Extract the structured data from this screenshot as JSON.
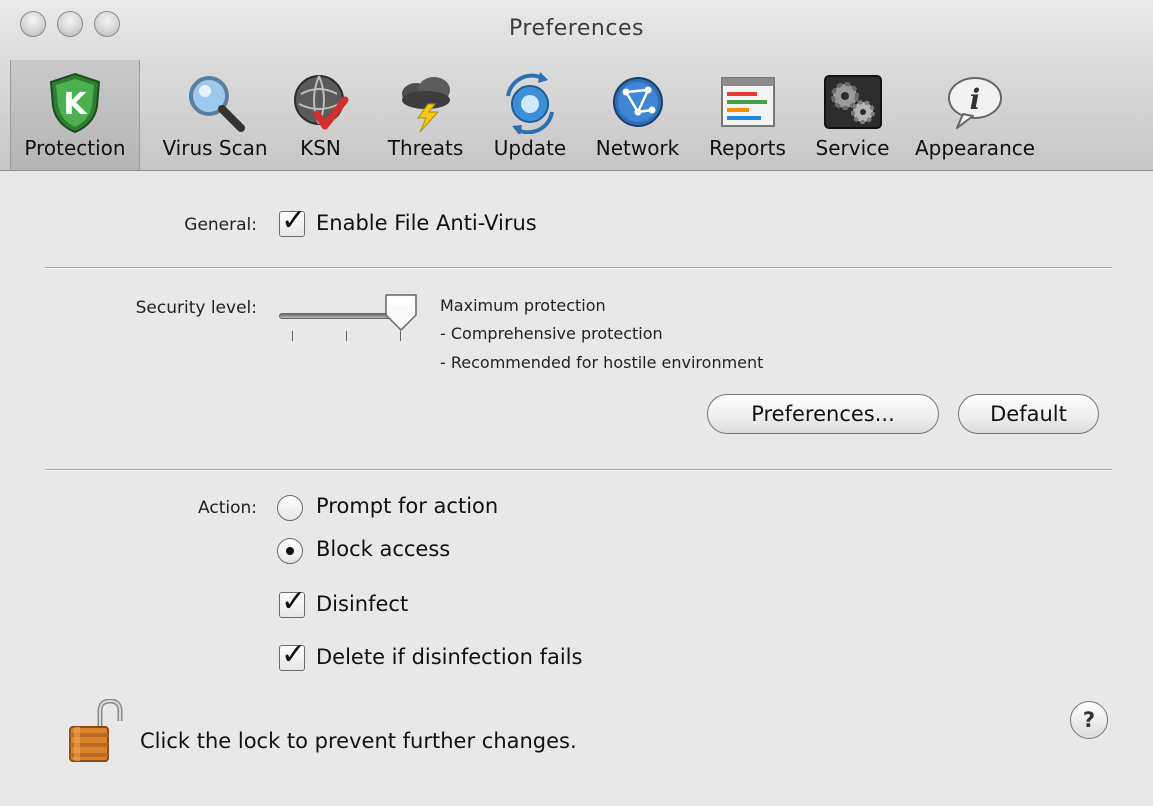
{
  "window": {
    "title": "Preferences"
  },
  "toolbar": {
    "items": [
      {
        "label": "Protection",
        "icon": "shield-k-icon",
        "selected": true
      },
      {
        "label": "Virus Scan",
        "icon": "magnifier-icon"
      },
      {
        "label": "KSN",
        "icon": "ksn-globe-icon"
      },
      {
        "label": "Threats",
        "icon": "storm-cloud-icon"
      },
      {
        "label": "Update",
        "icon": "update-orbit-icon"
      },
      {
        "label": "Network",
        "icon": "network-globe-icon"
      },
      {
        "label": "Reports",
        "icon": "report-sheet-icon"
      },
      {
        "label": "Service",
        "icon": "gears-icon"
      },
      {
        "label": "Appearance",
        "icon": "info-bubble-icon"
      }
    ]
  },
  "general": {
    "label": "General:",
    "enable_label": "Enable File Anti-Virus",
    "enabled": true
  },
  "security": {
    "label": "Security level:",
    "level_index": 2,
    "levels": 3,
    "description": [
      "Maximum protection",
      "- Comprehensive protection",
      "- Recommended for hostile environment"
    ],
    "preferences_button": "Preferences...",
    "default_button": "Default"
  },
  "action": {
    "label": "Action:",
    "options": [
      {
        "label": "Prompt for action",
        "selected": false
      },
      {
        "label": "Block access",
        "selected": true
      }
    ],
    "disinfect_label": "Disinfect",
    "disinfect_checked": true,
    "delete_label": "Delete if disinfection fails",
    "delete_checked": true
  },
  "footer": {
    "lock_text": "Click the lock to prevent further changes.",
    "help_symbol": "?"
  }
}
